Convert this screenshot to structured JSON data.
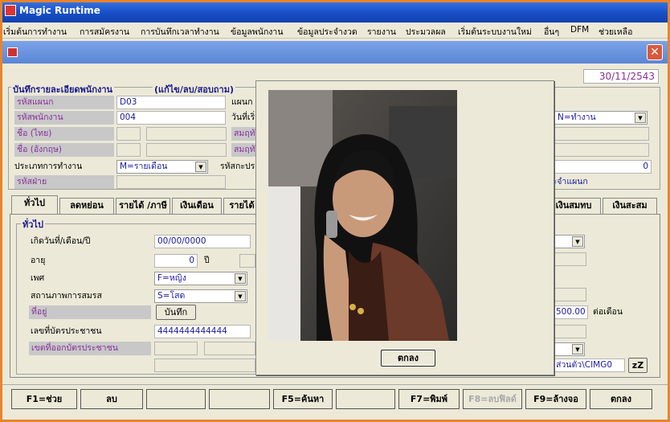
{
  "window": {
    "title": "Magic Runtime"
  },
  "menu": [
    "เริ่มต้นการทำงาน",
    "การสมัครงาน",
    "การบันทึกเวลาทำงาน",
    "ข้อมูลพนักงาน",
    "ข้อมูลประจำงวด",
    "รายงาน",
    "ประมวลผล",
    "เริ่มต้นระบบงานใหม่",
    "อื่นๆ",
    "DFM",
    "ช่วยเหลือ"
  ],
  "child": {
    "close": "✕"
  },
  "date": "30/11/2543",
  "form": {
    "legend": "บันทึกรายละเอียดพนักงาน",
    "mode": "(แก้ไข/ลบ/สอบถาม)",
    "dept_label": "รหัสแผนก",
    "dept_value": "D03",
    "dept_right_label": "แผนก",
    "emp_label": "รหัสพนักงาน",
    "emp_value": "004",
    "start_label": "วันที่เริ่ม",
    "name_th_label": "ชื่อ (ไทย)",
    "name_en_label": "ชื่อ (อังกฤษ)",
    "spouse1_label": "สมฤทัย",
    "spouse2_label": "สมฤทัย",
    "worktype_label": "ประเภทการทำงาน",
    "worktype_value": "M=รายเดือน",
    "insurance_label": "รหัสกะประ",
    "division_label": "รหัสฝ่าย",
    "status_value": "N=ทำงาน",
    "right_number": "0",
    "right_dept_text": "ระจำแผนก"
  },
  "tabs": [
    "ทั่วไป",
    "ลดหย่อน",
    "รายได้ /ภาษี",
    "เงินเดือน",
    "รายได้",
    "เงินสมทบ",
    "เงินสะสม"
  ],
  "general": {
    "legend": "ทั่วไป",
    "dob_label": "เกิดวันที่/เดือน/ปี",
    "dob_value": "00/00/0000",
    "age_label": "อายุ",
    "age_value": "0",
    "age_unit": "ปี",
    "sex_label": "เพศ",
    "sex_value": "F=หญิง",
    "marital_label": "สถานภาพการสมรส",
    "marital_value": "S=โสด",
    "address_label": "ที่อยู่",
    "save_button": "บันทึก",
    "idcard_label": "เลขที่บัตรประชาชน",
    "idcard_value": "4444444444444",
    "issue_label": "เขตที่ออกบัตรประชาชน",
    "salary_value": "500.00",
    "salary_unit": "ต่อเดือน",
    "path_value": "ส่วนตัว\\CIMG0",
    "zz_button": "zZ"
  },
  "dialog": {
    "ok_button": "ตกลง"
  },
  "fkeys": [
    "F1=ช่วย",
    "ลบ",
    "",
    "",
    "F5=ค้นหา",
    "",
    "F7=พิมพ์",
    "F8=ลบฟิลด์",
    "F9=ล้างจอ",
    "ตกลง"
  ]
}
